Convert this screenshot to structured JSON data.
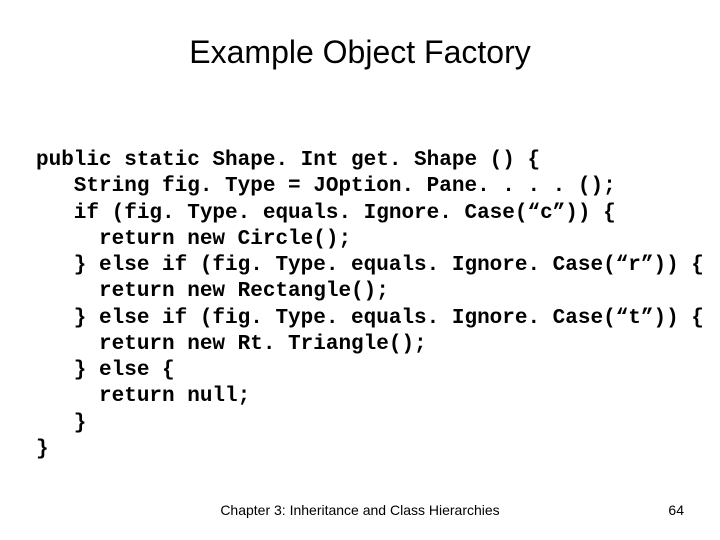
{
  "title": "Example Object Factory",
  "code": {
    "l0": "public static Shape. Int get. Shape () {",
    "l1": "   String fig. Type = JOption. Pane. . . . ();",
    "l2": "   if (fig. Type. equals. Ignore. Case(“c”)) {",
    "l3": "     return new Circle();",
    "l4": "   } else if (fig. Type. equals. Ignore. Case(“r”)) {",
    "l5": "     return new Rectangle();",
    "l6": "   } else if (fig. Type. equals. Ignore. Case(“t”)) {",
    "l7": "     return new Rt. Triangle();",
    "l8": "   } else {",
    "l9": "     return null;",
    "l10": "   }",
    "l11": "}"
  },
  "footer": {
    "chapter": "Chapter 3: Inheritance and Class Hierarchies",
    "page": "64"
  }
}
